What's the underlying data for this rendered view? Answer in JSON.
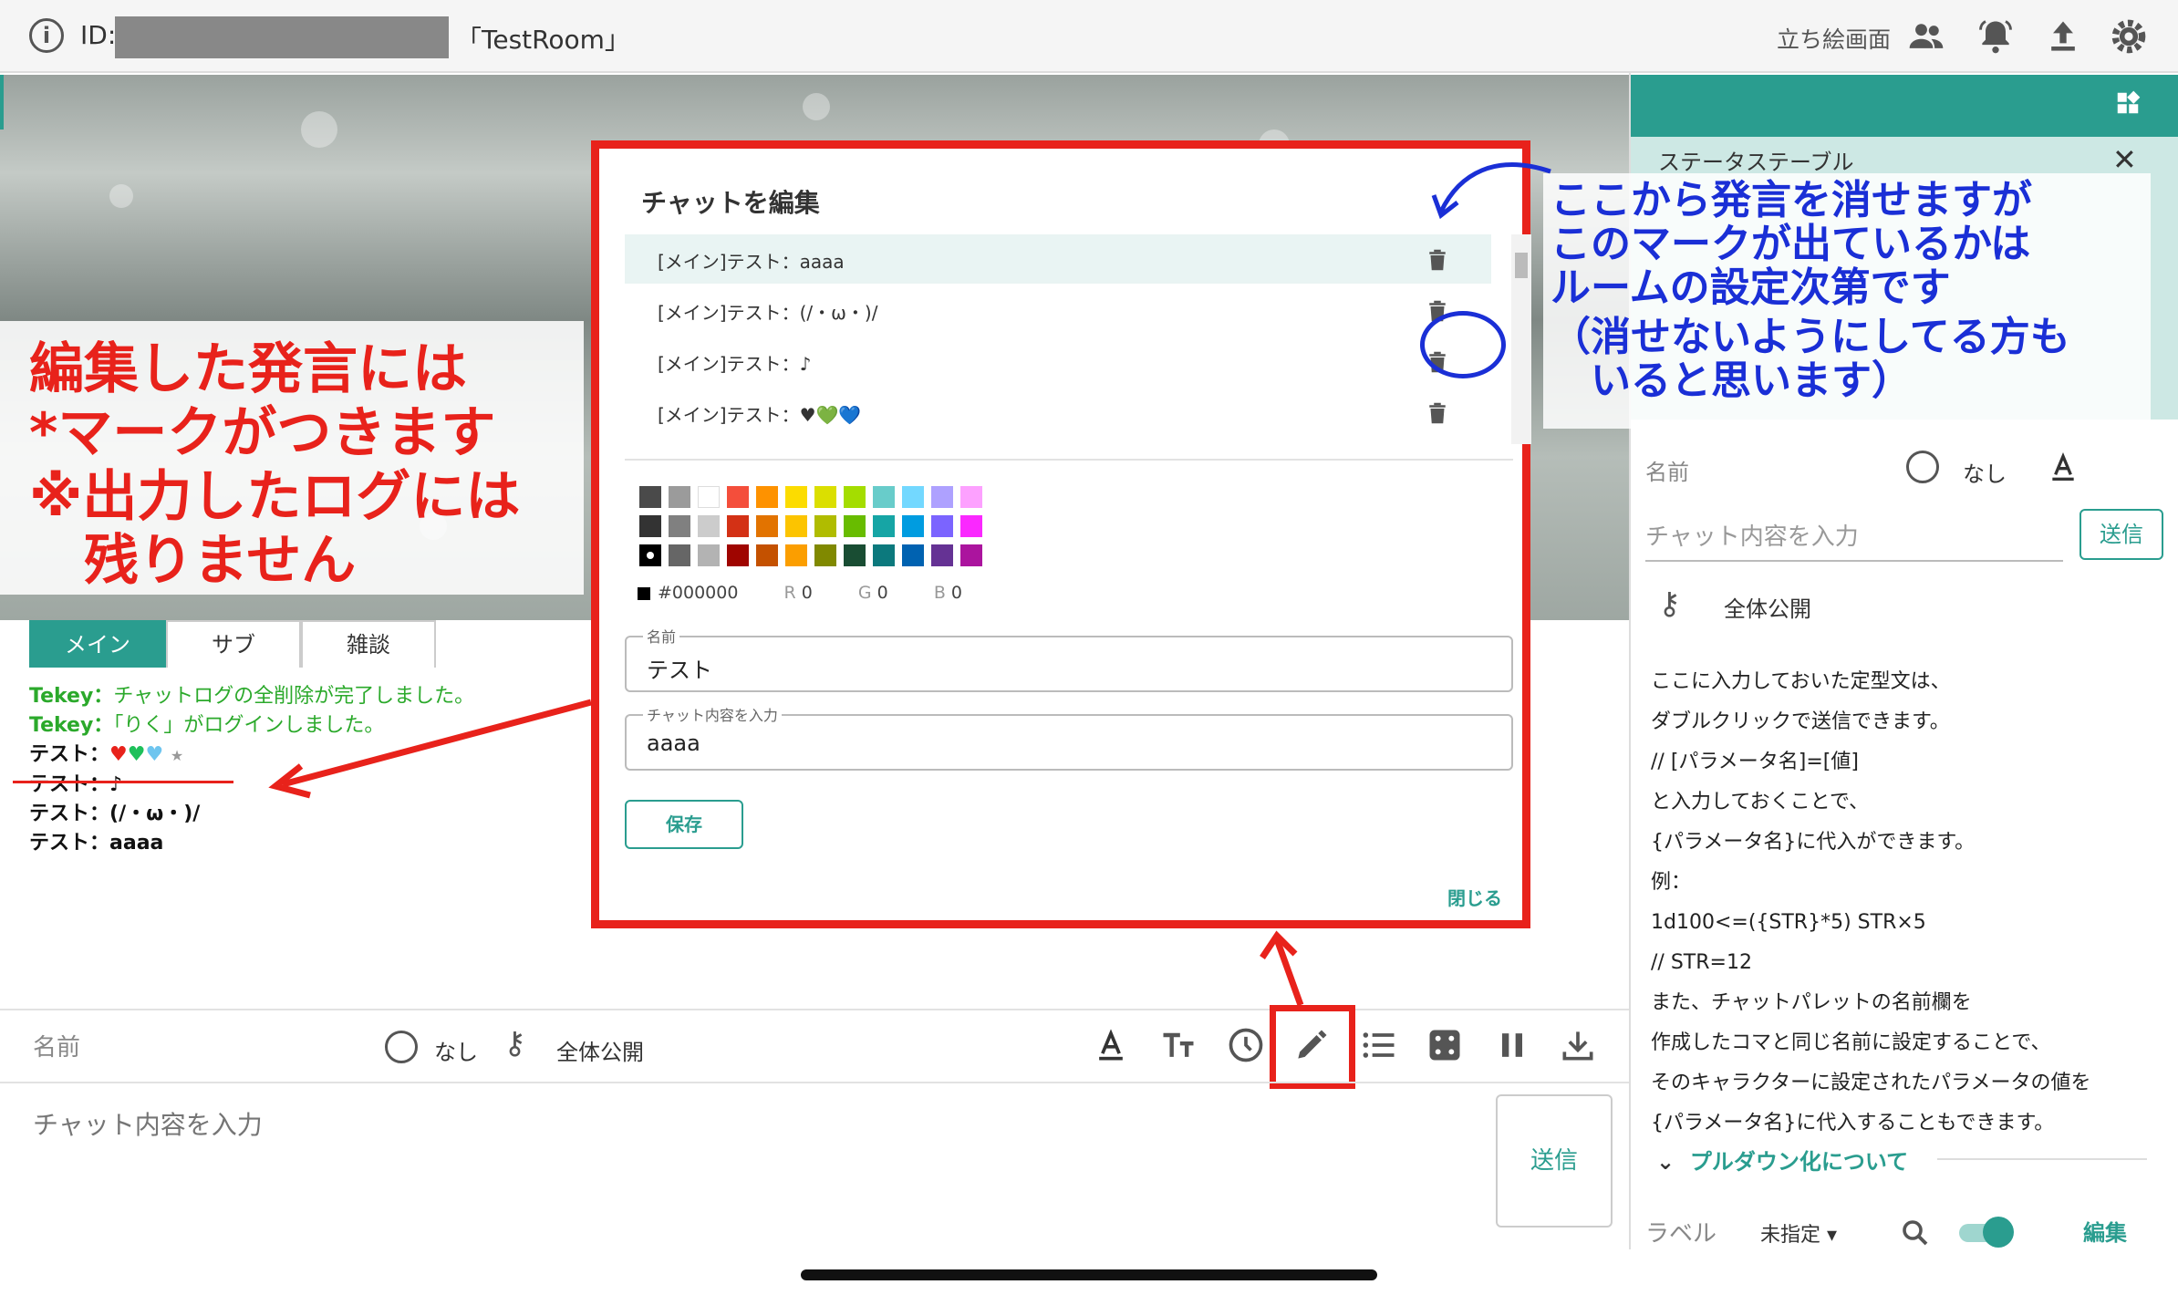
{
  "topbar": {
    "id_label": "ID:",
    "room_name": "「TestRoom」",
    "tachie_label": "立ち絵画面",
    "icons": [
      "info-icon",
      "people-icon",
      "bell-icon",
      "upload-icon",
      "gear-icon"
    ]
  },
  "annotations": {
    "red_lines": [
      "編集した発言には",
      "*マークがつきます",
      "※出力したログには",
      "　残りません"
    ],
    "blue_lines": [
      "ここから発言を消せますが",
      "このマークが出ているかは",
      "ルームの設定次第です",
      "（消せないようにしてる方も",
      "　いると思います）"
    ]
  },
  "tabs": [
    {
      "label": "メイン",
      "active": true
    },
    {
      "label": "サブ",
      "active": false
    },
    {
      "label": "雑談",
      "active": false
    }
  ],
  "chatlog": {
    "system": [
      {
        "speaker": "Tekey：",
        "text": "チャットログの全削除が完了しました。"
      },
      {
        "speaker": "Tekey：",
        "text": "「りく」がログインしました。"
      }
    ],
    "messages": [
      {
        "speaker": "テスト：",
        "text": "♥💚💙",
        "edited_mark": "★"
      },
      {
        "speaker": "テスト：",
        "text": "♪",
        "edited_mark": ""
      },
      {
        "speaker": "テスト：",
        "text": "(/・ω・)/",
        "edited_mark": ""
      },
      {
        "speaker": "テスト：",
        "text": "aaaa",
        "edited_mark": ""
      }
    ]
  },
  "input_bar": {
    "name_label": "名前",
    "face_value": "なし",
    "visibility": "全体公開",
    "placeholder": "チャット内容を入力",
    "send_label": "送信",
    "tools": [
      "text-color-icon",
      "font-size-icon",
      "clock-icon",
      "pencil-icon",
      "list-icon",
      "dice-icon",
      "pause-icon",
      "download-icon"
    ]
  },
  "dialog": {
    "title": "チャットを編集",
    "rows": [
      {
        "text": "[メイン]テスト：aaaa",
        "selected": true
      },
      {
        "text": "[メイン]テスト：(/・ω・)/",
        "selected": false
      },
      {
        "text": "[メイン]テスト：♪",
        "selected": false
      },
      {
        "text": "[メイン]テスト：♥💚💙",
        "selected": false
      }
    ],
    "color_hex": "#000000",
    "r_label": "R",
    "r_value": "0",
    "g_label": "G",
    "g_value": "0",
    "b_label": "B",
    "b_value": "0",
    "name_field_label": "名前",
    "name_field_value": "テスト",
    "content_field_label": "チャット内容を入力",
    "content_field_value": "aaaa",
    "save_label": "保存",
    "close_label": "閉じる",
    "palette": [
      [
        "#4a4a4a",
        "#9b9b9b",
        "#ffffff",
        "#f44e3b",
        "#fe9200",
        "#fcdc00",
        "#dbdf00",
        "#a4dd00",
        "#68ccca",
        "#73d8ff",
        "#aea1ff",
        "#fda1ff"
      ],
      [
        "#333333",
        "#808080",
        "#cccccc",
        "#d33115",
        "#e27300",
        "#fcc400",
        "#b0bc00",
        "#68bc00",
        "#16a5a5",
        "#009ce0",
        "#7b64ff",
        "#fa28ff"
      ],
      [
        "#000000",
        "#666666",
        "#b3b3b3",
        "#9f0500",
        "#c45100",
        "#fb9e00",
        "#808900",
        "#194d33",
        "#0c797d",
        "#0062b1",
        "#653294",
        "#ab149e"
      ]
    ]
  },
  "right_panel": {
    "status_title": "ステータステーブル",
    "name_label": "名前",
    "face_value": "なし",
    "placeholder": "チャット内容を入力",
    "send_label": "送信",
    "visibility": "全体公開",
    "palette_lines": [
      "ここに入力しておいた定型文は、",
      "ダブルクリックで送信できます。",
      "// [パラメータ名]=[値]",
      "と入力しておくことで、",
      "{パラメータ名}に代入ができます。",
      "例：",
      "1d100<=({STR}*5) STR×5",
      "// STR=12",
      "また、チャットパレットの名前欄を",
      "作成したコマと同じ名前に設定することで、",
      "そのキャラクターに設定されたパラメータの値を",
      "{パラメータ名}に代入することもできます。"
    ],
    "pulldown_label": "プルダウン化について",
    "label_label": "ラベル",
    "label_value": "未指定",
    "edit_label": "編集"
  }
}
